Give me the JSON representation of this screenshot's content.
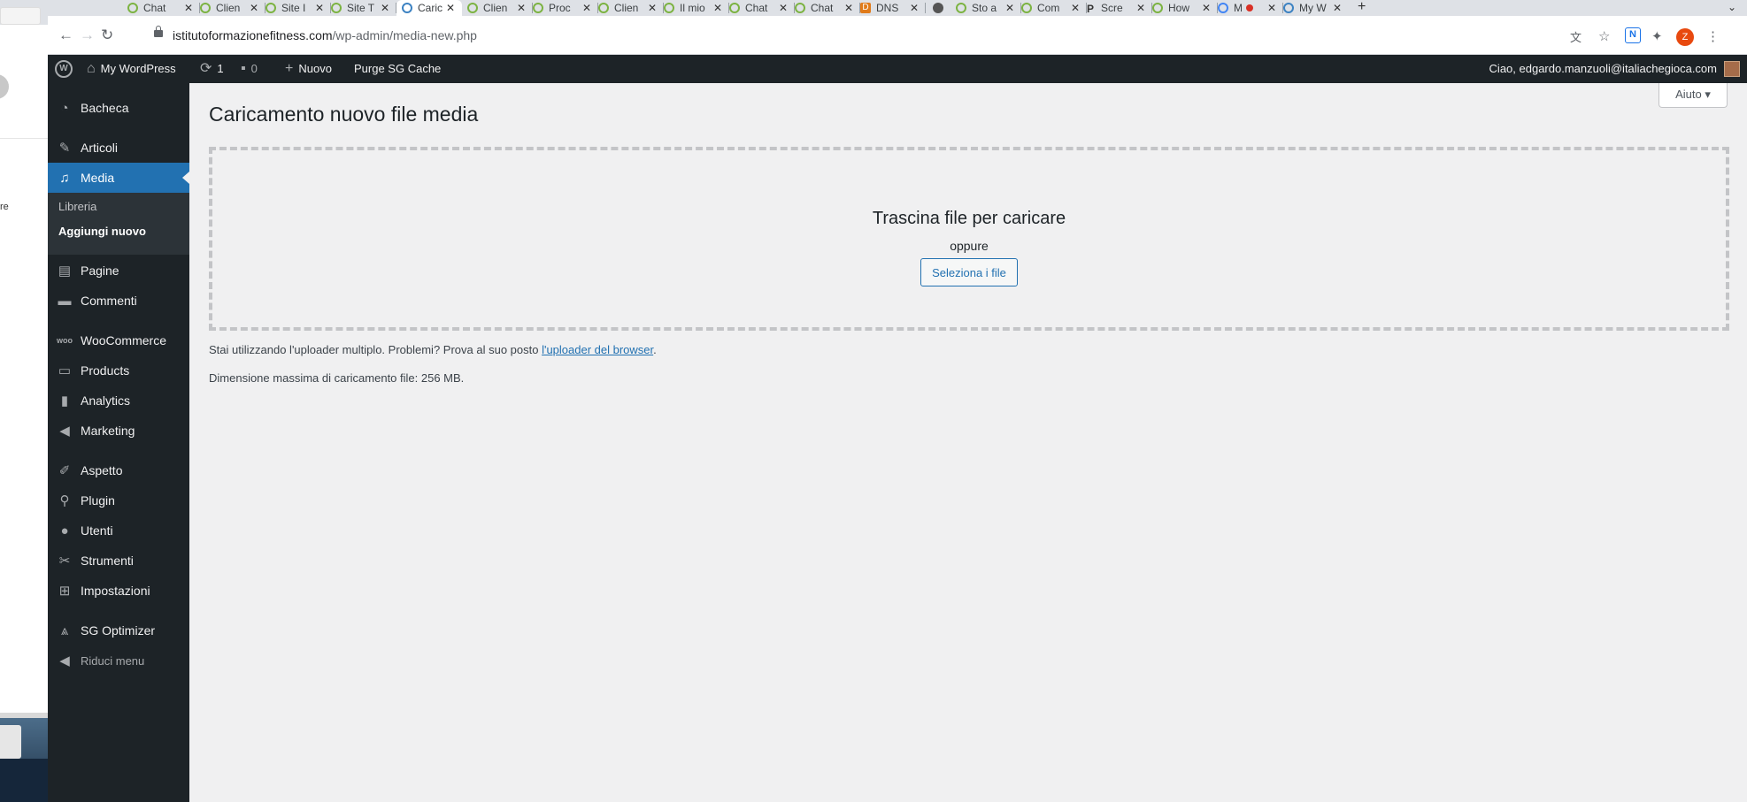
{
  "browser": {
    "tabs": [
      {
        "label": "Chat",
        "icon": "generic-favicon",
        "active": false
      },
      {
        "label": "Clien",
        "icon": "generic-favicon",
        "active": false
      },
      {
        "label": "Site I",
        "icon": "generic-favicon",
        "active": false
      },
      {
        "label": "Site T",
        "icon": "generic-favicon",
        "active": false
      },
      {
        "label": "Caric",
        "icon": "wordpress-favicon",
        "active": true
      },
      {
        "label": "Clien",
        "icon": "generic-favicon",
        "active": false
      },
      {
        "label": "Proc",
        "icon": "generic-favicon",
        "active": false
      },
      {
        "label": "Clien",
        "icon": "generic-favicon",
        "active": false
      },
      {
        "label": "Il mio",
        "icon": "generic-favicon",
        "active": false
      },
      {
        "label": "Chat",
        "icon": "generic-favicon",
        "active": false
      },
      {
        "label": "Chat",
        "icon": "generic-favicon",
        "active": false
      },
      {
        "label": "DNS",
        "icon": "d-favicon",
        "active": false
      },
      {
        "label": "",
        "icon": "dot-favicon",
        "active": false
      },
      {
        "label": "Sto a",
        "icon": "generic-favicon",
        "active": false
      },
      {
        "label": "Com",
        "icon": "generic-favicon",
        "active": false
      },
      {
        "label": "Scre",
        "icon": "p-favicon",
        "active": false
      },
      {
        "label": "How",
        "icon": "generic-favicon",
        "active": false
      },
      {
        "label": "M",
        "icon": "google-favicon",
        "active": false
      },
      {
        "label": "My W",
        "icon": "wordpress-favicon",
        "active": false
      }
    ],
    "url_host": "istitutoformazionefitness.com",
    "url_path": "/wp-admin/media-new.php",
    "profile_initial": "Z",
    "new_tab_glyph": "+"
  },
  "sliver": {
    "text": "re"
  },
  "adminbar": {
    "site_name": "My WordPress",
    "updates_count": "1",
    "comments_count": "0",
    "new_label": "Nuovo",
    "purge_label": "Purge SG Cache",
    "greeting": "Ciao, edgardo.manzuoli@italiachegioca.com"
  },
  "sidebar": {
    "items": [
      {
        "label": "Bacheca",
        "icon": "dashboard-icon"
      },
      {
        "label": "Articoli",
        "icon": "pin-icon"
      },
      {
        "label": "Media",
        "icon": "media-icon"
      },
      {
        "label": "Pagine",
        "icon": "pages-icon"
      },
      {
        "label": "Commenti",
        "icon": "comments-icon"
      },
      {
        "label": "WooCommerce",
        "icon": "woocommerce-icon"
      },
      {
        "label": "Products",
        "icon": "products-icon"
      },
      {
        "label": "Analytics",
        "icon": "analytics-icon"
      },
      {
        "label": "Marketing",
        "icon": "megaphone-icon"
      },
      {
        "label": "Aspetto",
        "icon": "brush-icon"
      },
      {
        "label": "Plugin",
        "icon": "plugin-icon"
      },
      {
        "label": "Utenti",
        "icon": "users-icon"
      },
      {
        "label": "Strumenti",
        "icon": "wrench-icon"
      },
      {
        "label": "Impostazioni",
        "icon": "settings-icon"
      },
      {
        "label": "SG Optimizer",
        "icon": "sg-optimizer-icon"
      }
    ],
    "submenu": {
      "library": "Libreria",
      "add_new": "Aggiungi nuovo"
    },
    "collapse_label": "Riduci menu"
  },
  "main": {
    "help_label": "Aiuto",
    "title": "Caricamento nuovo file media",
    "drop_title": "Trascina file per caricare",
    "drop_or": "oppure",
    "select_button": "Seleziona i file",
    "uploader_note_prefix": "Stai utilizzando l'uploader multiplo. Problemi? Prova al suo posto ",
    "uploader_note_link": "l'uploader del browser",
    "uploader_note_suffix": ".",
    "max_size_note": "Dimensione massima di caricamento file: 256 MB."
  }
}
